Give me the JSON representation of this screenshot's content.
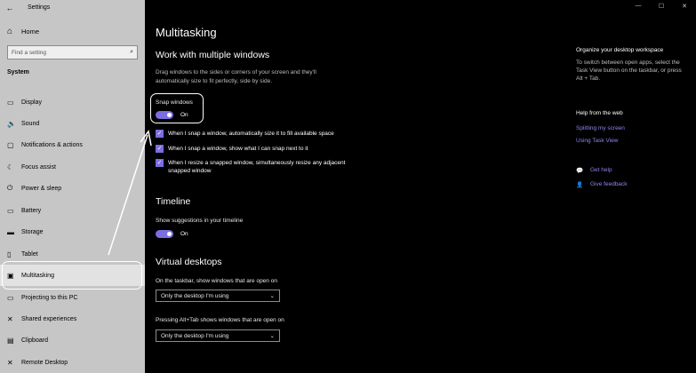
{
  "window": {
    "title": "Settings",
    "back_glyph": "←",
    "min_glyph": "—",
    "max_glyph": "☐",
    "close_glyph": "✕"
  },
  "sidebar": {
    "home_label": "Home",
    "search_placeholder": "Find a setting",
    "section_label": "System",
    "items": [
      {
        "label": "Display",
        "icon": "display-icon",
        "glyph": "▭"
      },
      {
        "label": "Sound",
        "icon": "sound-icon",
        "glyph": "🔈"
      },
      {
        "label": "Notifications & actions",
        "icon": "notifications-icon",
        "glyph": "▢"
      },
      {
        "label": "Focus assist",
        "icon": "focus-assist-icon",
        "glyph": "☾"
      },
      {
        "label": "Power & sleep",
        "icon": "power-icon",
        "glyph": "⏻"
      },
      {
        "label": "Battery",
        "icon": "battery-icon",
        "glyph": "▭"
      },
      {
        "label": "Storage",
        "icon": "storage-icon",
        "glyph": "▬"
      },
      {
        "label": "Tablet",
        "icon": "tablet-icon",
        "glyph": "▯"
      },
      {
        "label": "Multitasking",
        "icon": "multitasking-icon",
        "glyph": "▣",
        "active": true
      },
      {
        "label": "Projecting to this PC",
        "icon": "projecting-icon",
        "glyph": "▭"
      },
      {
        "label": "Shared experiences",
        "icon": "shared-experiences-icon",
        "glyph": "✕"
      },
      {
        "label": "Clipboard",
        "icon": "clipboard-icon",
        "glyph": "▤"
      },
      {
        "label": "Remote Desktop",
        "icon": "remote-desktop-icon",
        "glyph": "✕"
      }
    ]
  },
  "main": {
    "page_title": "Multitasking",
    "snap_section": {
      "heading": "Work with multiple windows",
      "description": "Drag windows to the sides or corners of your screen and they'll automatically size to fit perfectly, side by side.",
      "toggle_label": "Snap windows",
      "toggle_state": "On",
      "checkboxes": [
        "When I snap a window, automatically size it to fill available space",
        "When I snap a window, show what I can snap next to it",
        "When I resize a snapped window, simultaneously resize any adjacent snapped window"
      ]
    },
    "timeline_section": {
      "heading": "Timeline",
      "toggle_label": "Show suggestions in your timeline",
      "toggle_state": "On"
    },
    "virtual_desktops_section": {
      "heading": "Virtual desktops",
      "taskbar_label": "On the taskbar, show windows that are open on",
      "taskbar_value": "Only the desktop I'm using",
      "alttab_label": "Pressing Alt+Tab shows windows that are open on",
      "alttab_value": "Only the desktop I'm using"
    }
  },
  "right_panel": {
    "organize_title": "Organize your desktop workspace",
    "organize_desc": "To switch between open apps, select the Task View button on the taskbar, or press Alt + Tab.",
    "help_title": "Help from the web",
    "help_links": [
      "Splitting my screen",
      "Using Task View"
    ],
    "get_help": "Get help",
    "give_feedback": "Give feedback"
  },
  "colors": {
    "accent": "#7a6ee0",
    "link": "#8e86ef",
    "sidebar_bg": "#c6c6c6",
    "main_bg": "#000000"
  }
}
